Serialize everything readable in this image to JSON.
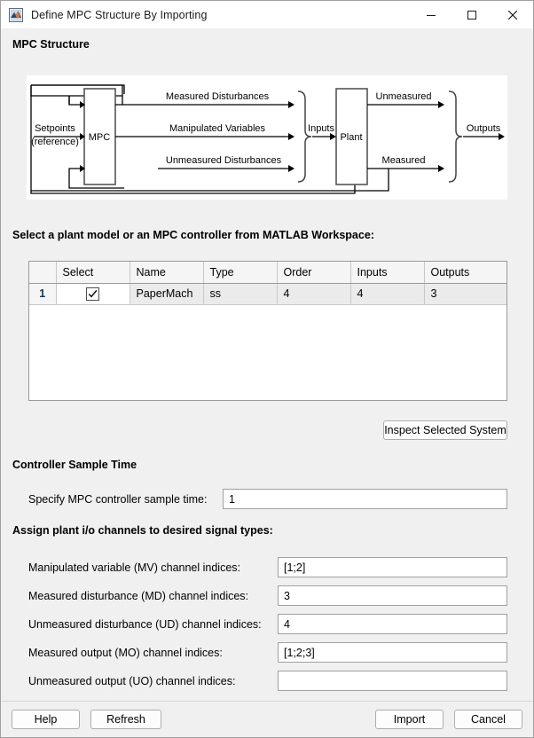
{
  "window": {
    "title": "Define MPC Structure By Importing",
    "icon": "matlab-icon",
    "minimize": "minimize-icon",
    "maximize": "maximize-icon",
    "close": "close-icon"
  },
  "sections": {
    "mpc_structure": "MPC Structure",
    "select_model": "Select a plant model or an MPC controller from MATLAB Workspace:",
    "controller_sample_time": "Controller Sample Time",
    "assign_channels": "Assign plant i/o channels to desired signal types:"
  },
  "diagram": {
    "blocks": {
      "mpc": "MPC",
      "plant": "Plant"
    },
    "labels": {
      "setpoints_line1": "Setpoints",
      "setpoints_line2": "(reference)",
      "measured_disturbances": "Measured Disturbances",
      "manipulated_variables": "Manipulated Variables",
      "unmeasured_disturbances": "Unmeasured Disturbances",
      "inputs": "Inputs",
      "unmeasured": "Unmeasured",
      "measured": "Measured",
      "outputs": "Outputs"
    }
  },
  "table": {
    "columns": [
      "",
      "Select",
      "Name",
      "Type",
      "Order",
      "Inputs",
      "Outputs"
    ],
    "rows": [
      {
        "index": "1",
        "selected": true,
        "name": "PaperMach",
        "type": "ss",
        "order": "4",
        "inputs": "4",
        "outputs": "3"
      }
    ]
  },
  "buttons": {
    "inspect": "Inspect Selected System",
    "help": "Help",
    "refresh": "Refresh",
    "import": "Import",
    "cancel": "Cancel"
  },
  "sample_time": {
    "label": "Specify MPC controller sample time:",
    "value": "1",
    "placeholder": ""
  },
  "channels": [
    {
      "label": "Manipulated variable (MV) channel indices:",
      "value": "[1;2]"
    },
    {
      "label": "Measured disturbance (MD) channel indices:",
      "value": "3"
    },
    {
      "label": "Unmeasured disturbance (UD) channel indices:",
      "value": "4"
    },
    {
      "label": "Measured output (MO) channel indices:",
      "value": "[1;2;3]"
    },
    {
      "label": "Unmeasured output (UO) channel indices:",
      "value": ""
    }
  ],
  "colors": {
    "window_bg": "#f0f0f0",
    "panel_white": "#ffffff",
    "header_row": "#f5f5f5",
    "data_row": "#ebebeb",
    "rownum_text": "#12395b",
    "border": "#9a9a9a"
  }
}
